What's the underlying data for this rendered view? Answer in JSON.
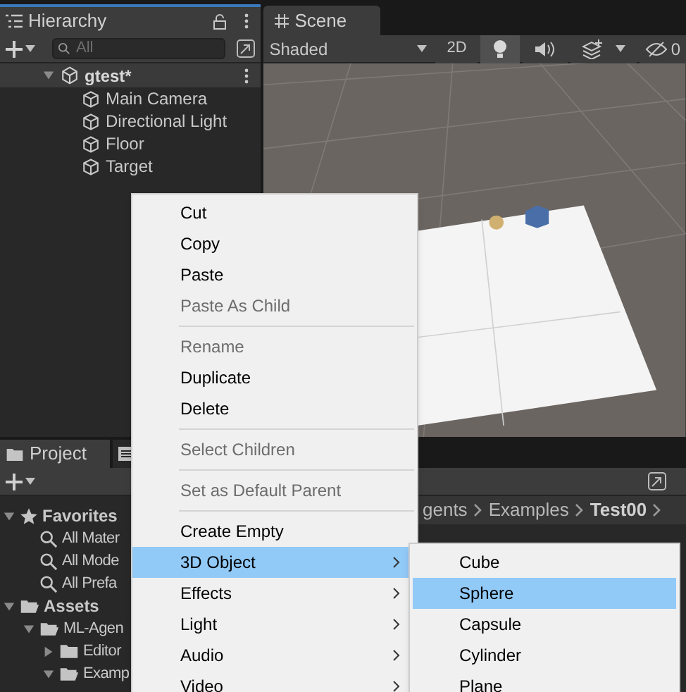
{
  "hierarchy": {
    "tab": "Hierarchy",
    "search": {
      "placeholder": "All"
    },
    "scene": {
      "name": "gtest*",
      "expanded": true,
      "children": [
        {
          "name": "Main Camera"
        },
        {
          "name": "Directional Light"
        },
        {
          "name": "Floor"
        },
        {
          "name": "Target"
        }
      ]
    }
  },
  "scene_view": {
    "tab": "Scene",
    "shading": "Shaded",
    "toggles": [
      {
        "kind": "text",
        "label": "2D",
        "on": false
      },
      {
        "kind": "light",
        "on": true
      },
      {
        "kind": "audio",
        "on": false
      },
      {
        "kind": "effects",
        "on": false
      }
    ],
    "hidden_count": "0"
  },
  "project": {
    "tab": "Project",
    "breadcrumbs": [
      "gents",
      "Examples",
      "Test00"
    ],
    "tree": [
      {
        "name": "Favorites",
        "kind": "favorites",
        "expanded": true,
        "children": [
          {
            "name": "All Mater",
            "kind": "search"
          },
          {
            "name": "All Mode",
            "kind": "search"
          },
          {
            "name": "All Prefa",
            "kind": "search"
          }
        ]
      },
      {
        "name": "Assets",
        "kind": "folder",
        "expanded": true,
        "children": [
          {
            "name": "ML-Agen",
            "kind": "folder",
            "expanded": true,
            "children": [
              {
                "name": "Editor",
                "kind": "folder",
                "expanded": false
              },
              {
                "name": "Examp",
                "kind": "folder",
                "expanded": true
              }
            ]
          }
        ]
      }
    ]
  },
  "context_menu": {
    "items": [
      {
        "kind": "item",
        "label": "Cut",
        "disabled": false,
        "submenu": false,
        "selected": false
      },
      {
        "kind": "item",
        "label": "Copy",
        "disabled": false,
        "submenu": false,
        "selected": false
      },
      {
        "kind": "item",
        "label": "Paste",
        "disabled": false,
        "submenu": false,
        "selected": false
      },
      {
        "kind": "item",
        "label": "Paste As Child",
        "disabled": true,
        "submenu": false,
        "selected": false
      },
      {
        "kind": "separator"
      },
      {
        "kind": "item",
        "label": "Rename",
        "disabled": true,
        "submenu": false,
        "selected": false
      },
      {
        "kind": "item",
        "label": "Duplicate",
        "disabled": false,
        "submenu": false,
        "selected": false
      },
      {
        "kind": "item",
        "label": "Delete",
        "disabled": false,
        "submenu": false,
        "selected": false
      },
      {
        "kind": "separator"
      },
      {
        "kind": "item",
        "label": "Select Children",
        "disabled": true,
        "submenu": false,
        "selected": false
      },
      {
        "kind": "separator"
      },
      {
        "kind": "item",
        "label": "Set as Default Parent",
        "disabled": true,
        "submenu": false,
        "selected": false
      },
      {
        "kind": "separator"
      },
      {
        "kind": "item",
        "label": "Create Empty",
        "disabled": false,
        "submenu": false,
        "selected": false
      },
      {
        "kind": "item",
        "label": "3D Object",
        "disabled": false,
        "submenu": true,
        "selected": true
      },
      {
        "kind": "item",
        "label": "Effects",
        "disabled": false,
        "submenu": true,
        "selected": false
      },
      {
        "kind": "item",
        "label": "Light",
        "disabled": false,
        "submenu": true,
        "selected": false
      },
      {
        "kind": "item",
        "label": "Audio",
        "disabled": false,
        "submenu": true,
        "selected": false
      },
      {
        "kind": "item",
        "label": "Video",
        "disabled": false,
        "submenu": true,
        "selected": false
      }
    ]
  },
  "submenu": {
    "items": [
      {
        "label": "Cube",
        "selected": false
      },
      {
        "label": "Sphere",
        "selected": true
      },
      {
        "label": "Capsule",
        "selected": false
      },
      {
        "label": "Cylinder",
        "selected": false
      },
      {
        "label": "Plane",
        "selected": false
      }
    ]
  }
}
